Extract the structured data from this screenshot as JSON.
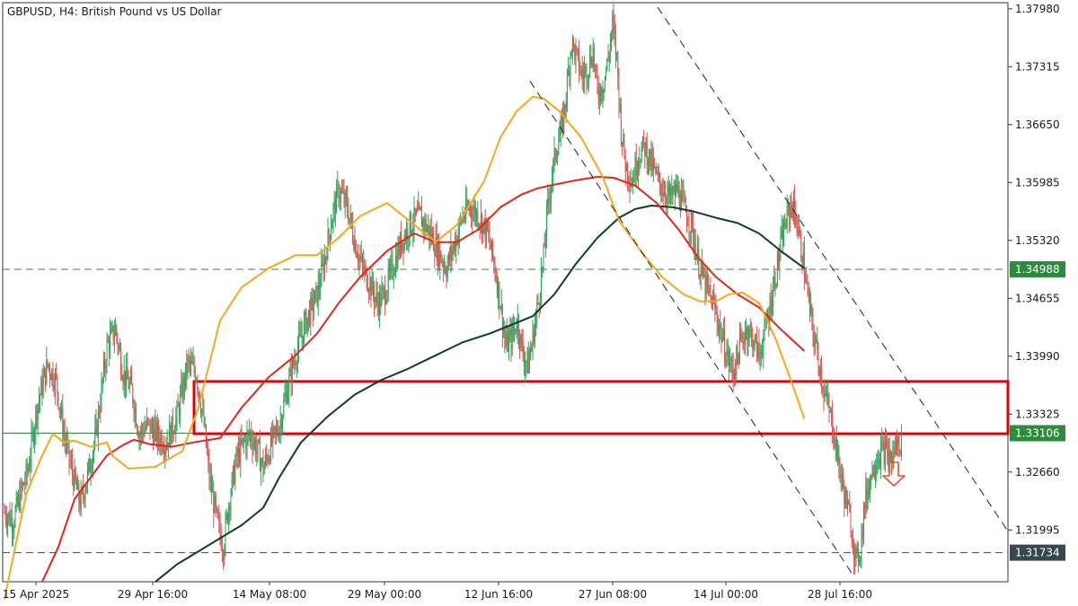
{
  "chart_data": {
    "type": "candlestick",
    "title": "GBPUSD, H4:  British Pound vs US Dollar",
    "ylim": [
      1.314,
      1.3805
    ],
    "y_ticks": [
      "1.37980",
      "1.37315",
      "1.36650",
      "1.35985",
      "1.35320",
      "1.34655",
      "1.33990",
      "1.33325",
      "1.32660",
      "1.31995"
    ],
    "x_ticks": [
      "15 Apr 2025",
      "29 Apr 16:00",
      "14 May 08:00",
      "29 May 00:00",
      "12 Jun 16:00",
      "27 Jun 08:00",
      "14 Jul 00:00",
      "28 Jul 16:00"
    ],
    "colors": {
      "bull": "#26a65b",
      "bear": "#d9534f",
      "ma_fast": "#f5a623",
      "ma_mid": "#e0261b",
      "ma_slow": "#0d3b2e",
      "level_green": "#2e8b3e",
      "level_dark": "#37474f",
      "zone": "#e0000a",
      "channel": "#222222",
      "arrow": "#e8502a"
    },
    "price_levels": [
      {
        "label": "1.34988",
        "value": 1.34988,
        "style": "dashed",
        "color": "#2e8b3e"
      },
      {
        "label": "1.33106",
        "value": 1.33106,
        "style": "solid",
        "color": "#2e8b3e"
      },
      {
        "label": "1.31734",
        "value": 1.31734,
        "style": "dashed",
        "color": "#37474f"
      }
    ],
    "zone": {
      "from_x": "2 May 2025",
      "y_top": 1.337,
      "y_bottom": 1.331
    },
    "ma_fast": [
      [
        0,
        1.312
      ],
      [
        20,
        1.324
      ],
      [
        35,
        1.3285
      ],
      [
        45,
        1.331
      ],
      [
        55,
        1.33
      ],
      [
        65,
        1.3302
      ],
      [
        80,
        1.3295
      ],
      [
        95,
        1.33
      ],
      [
        100,
        1.3285
      ],
      [
        115,
        1.327
      ],
      [
        140,
        1.3272
      ],
      [
        165,
        1.329
      ],
      [
        180,
        1.334
      ],
      [
        200,
        1.344
      ],
      [
        220,
        1.3478
      ],
      [
        245,
        1.35
      ],
      [
        270,
        1.3515
      ],
      [
        290,
        1.3515
      ],
      [
        310,
        1.3535
      ],
      [
        330,
        1.356
      ],
      [
        355,
        1.3575
      ],
      [
        380,
        1.355
      ],
      [
        400,
        1.353
      ],
      [
        420,
        1.355
      ],
      [
        445,
        1.36
      ],
      [
        460,
        1.365
      ],
      [
        475,
        1.368
      ],
      [
        490,
        1.3697
      ],
      [
        500,
        1.3695
      ],
      [
        515,
        1.368
      ],
      [
        535,
        1.365
      ],
      [
        555,
        1.3605
      ],
      [
        570,
        1.3555
      ],
      [
        590,
        1.352
      ],
      [
        610,
        1.349
      ],
      [
        630,
        1.347
      ],
      [
        645,
        1.3462
      ],
      [
        660,
        1.3462
      ],
      [
        672,
        1.347
      ],
      [
        685,
        1.3472
      ],
      [
        700,
        1.346
      ],
      [
        715,
        1.342
      ],
      [
        730,
        1.337
      ],
      [
        742,
        1.3327
      ]
    ],
    "ma_mid": [
      [
        35,
        1.314
      ],
      [
        50,
        1.318
      ],
      [
        65,
        1.3235
      ],
      [
        80,
        1.326
      ],
      [
        95,
        1.3285
      ],
      [
        110,
        1.3297
      ],
      [
        120,
        1.3303
      ],
      [
        135,
        1.3298
      ],
      [
        155,
        1.3295
      ],
      [
        175,
        1.33
      ],
      [
        200,
        1.3305
      ],
      [
        220,
        1.334
      ],
      [
        245,
        1.3375
      ],
      [
        270,
        1.34
      ],
      [
        290,
        1.3425
      ],
      [
        310,
        1.346
      ],
      [
        330,
        1.349
      ],
      [
        355,
        1.352
      ],
      [
        380,
        1.354
      ],
      [
        400,
        1.353
      ],
      [
        420,
        1.353
      ],
      [
        440,
        1.3545
      ],
      [
        460,
        1.357
      ],
      [
        480,
        1.3585
      ],
      [
        495,
        1.3592
      ],
      [
        510,
        1.3596
      ],
      [
        530,
        1.3601
      ],
      [
        550,
        1.3605
      ],
      [
        565,
        1.3604
      ],
      [
        585,
        1.3595
      ],
      [
        605,
        1.3575
      ],
      [
        625,
        1.3545
      ],
      [
        645,
        1.351
      ],
      [
        660,
        1.349
      ],
      [
        680,
        1.347
      ],
      [
        700,
        1.3455
      ],
      [
        720,
        1.343
      ],
      [
        742,
        1.3405
      ]
    ],
    "ma_slow": [
      [
        140,
        1.314
      ],
      [
        160,
        1.316
      ],
      [
        180,
        1.3175
      ],
      [
        200,
        1.319
      ],
      [
        220,
        1.3205
      ],
      [
        240,
        1.3225
      ],
      [
        255,
        1.326
      ],
      [
        275,
        1.33
      ],
      [
        300,
        1.333
      ],
      [
        325,
        1.3355
      ],
      [
        350,
        1.3372
      ],
      [
        375,
        1.3385
      ],
      [
        400,
        1.34
      ],
      [
        425,
        1.3415
      ],
      [
        450,
        1.3425
      ],
      [
        470,
        1.3435
      ],
      [
        490,
        1.3445
      ],
      [
        510,
        1.347
      ],
      [
        530,
        1.3505
      ],
      [
        550,
        1.3535
      ],
      [
        570,
        1.3558
      ],
      [
        585,
        1.3568
      ],
      [
        600,
        1.3572
      ],
      [
        620,
        1.357
      ],
      [
        640,
        1.3565
      ],
      [
        660,
        1.3558
      ],
      [
        680,
        1.3552
      ],
      [
        700,
        1.354
      ],
      [
        720,
        1.352
      ],
      [
        742,
        1.35
      ]
    ],
    "price_path": [
      [
        0,
        1.322
      ],
      [
        8,
        1.321
      ],
      [
        15,
        1.324
      ],
      [
        22,
        1.327
      ],
      [
        30,
        1.334
      ],
      [
        40,
        1.339
      ],
      [
        48,
        1.337
      ],
      [
        55,
        1.331
      ],
      [
        62,
        1.327
      ],
      [
        70,
        1.323
      ],
      [
        75,
        1.325
      ],
      [
        85,
        1.331
      ],
      [
        95,
        1.341
      ],
      [
        103,
        1.343
      ],
      [
        110,
        1.338
      ],
      [
        118,
        1.336
      ],
      [
        125,
        1.331
      ],
      [
        133,
        1.332
      ],
      [
        140,
        1.331
      ],
      [
        150,
        1.33
      ],
      [
        160,
        1.333
      ],
      [
        170,
        1.339
      ],
      [
        178,
        1.338
      ],
      [
        185,
        1.332
      ],
      [
        190,
        1.326
      ],
      [
        197,
        1.321
      ],
      [
        203,
        1.318
      ],
      [
        208,
        1.323
      ],
      [
        215,
        1.328
      ],
      [
        222,
        1.33
      ],
      [
        228,
        1.331
      ],
      [
        235,
        1.329
      ],
      [
        240,
        1.327
      ],
      [
        248,
        1.33
      ],
      [
        255,
        1.332
      ],
      [
        262,
        1.336
      ],
      [
        270,
        1.34
      ],
      [
        280,
        1.344
      ],
      [
        290,
        1.347
      ],
      [
        297,
        1.351
      ],
      [
        304,
        1.356
      ],
      [
        310,
        1.359
      ],
      [
        318,
        1.357
      ],
      [
        325,
        1.353
      ],
      [
        332,
        1.35
      ],
      [
        340,
        1.348
      ],
      [
        346,
        1.346
      ],
      [
        352,
        1.347
      ],
      [
        360,
        1.35
      ],
      [
        368,
        1.353
      ],
      [
        376,
        1.355
      ],
      [
        385,
        1.356
      ],
      [
        395,
        1.354
      ],
      [
        402,
        1.352
      ],
      [
        410,
        1.35
      ],
      [
        418,
        1.353
      ],
      [
        425,
        1.356
      ],
      [
        432,
        1.357
      ],
      [
        440,
        1.356
      ],
      [
        448,
        1.354
      ],
      [
        455,
        1.35
      ],
      [
        460,
        1.346
      ],
      [
        465,
        1.341
      ],
      [
        470,
        1.342
      ],
      [
        476,
        1.344
      ],
      [
        481,
        1.34
      ],
      [
        486,
        1.339
      ],
      [
        490,
        1.342
      ],
      [
        495,
        1.346
      ],
      [
        500,
        1.351
      ],
      [
        503,
        1.356
      ],
      [
        507,
        1.36
      ],
      [
        512,
        1.364
      ],
      [
        517,
        1.366
      ],
      [
        521,
        1.37
      ],
      [
        526,
        1.376
      ],
      [
        531,
        1.374
      ],
      [
        536,
        1.372
      ],
      [
        541,
        1.373
      ],
      [
        546,
        1.375
      ],
      [
        550,
        1.37
      ],
      [
        555,
        1.371
      ],
      [
        560,
        1.374
      ],
      [
        564,
        1.378
      ],
      [
        568,
        1.374
      ],
      [
        572,
        1.366
      ],
      [
        576,
        1.362
      ],
      [
        582,
        1.36
      ],
      [
        588,
        1.363
      ],
      [
        594,
        1.364
      ],
      [
        600,
        1.362
      ],
      [
        606,
        1.36
      ],
      [
        612,
        1.359
      ],
      [
        618,
        1.358
      ],
      [
        624,
        1.359
      ],
      [
        630,
        1.357
      ],
      [
        637,
        1.355
      ],
      [
        643,
        1.351
      ],
      [
        650,
        1.348
      ],
      [
        657,
        1.346
      ],
      [
        664,
        1.343
      ],
      [
        670,
        1.34
      ],
      [
        676,
        1.338
      ],
      [
        682,
        1.341
      ],
      [
        688,
        1.343
      ],
      [
        694,
        1.342
      ],
      [
        700,
        1.34
      ],
      [
        706,
        1.343
      ],
      [
        712,
        1.347
      ],
      [
        718,
        1.351
      ],
      [
        724,
        1.355
      ],
      [
        730,
        1.3575
      ],
      [
        734,
        1.356
      ],
      [
        738,
        1.353
      ],
      [
        742,
        1.35
      ],
      [
        746,
        1.346
      ],
      [
        751,
        1.342
      ],
      [
        756,
        1.339
      ],
      [
        760,
        1.336
      ],
      [
        764,
        1.334
      ],
      [
        768,
        1.332
      ],
      [
        772,
        1.329
      ],
      [
        776,
        1.326
      ],
      [
        781,
        1.323
      ],
      [
        786,
        1.32
      ],
      [
        790,
        1.316
      ],
      [
        794,
        1.318
      ],
      [
        798,
        1.323
      ],
      [
        803,
        1.326
      ],
      [
        808,
        1.328
      ],
      [
        813,
        1.329
      ],
      [
        818,
        1.329
      ],
      [
        823,
        1.328
      ],
      [
        828,
        1.33
      ],
      [
        832,
        1.33
      ]
    ],
    "channel_lines": [
      {
        "from": [
          1,
          1.3715
        ],
        "to": [
          3,
          1.315
        ]
      },
      {
        "from": [
          2,
          1.38
        ],
        "to": [
          4,
          1.3198
        ]
      }
    ],
    "marker": "down-arrow"
  }
}
